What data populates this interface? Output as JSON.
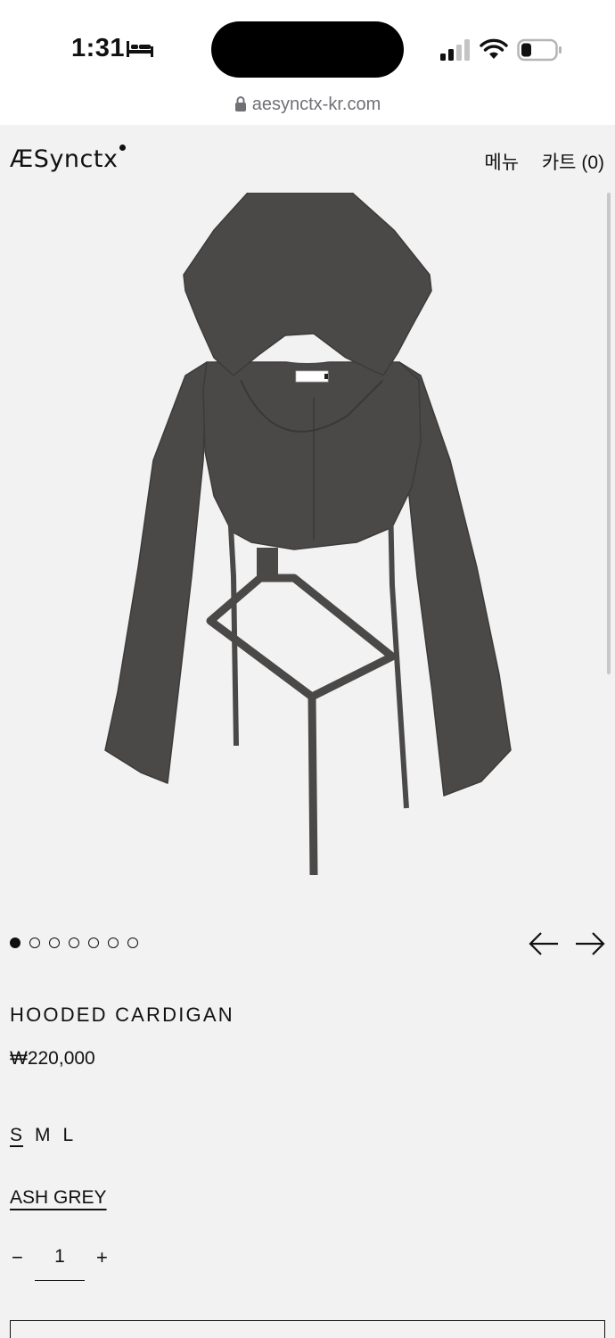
{
  "status_bar": {
    "time": "1:31",
    "url": "aesynctx-kr.com"
  },
  "header": {
    "logo_text": "ÆSynctx",
    "menu_label": "메뉴",
    "cart_label": "카트 (0)"
  },
  "gallery": {
    "image_count": 7,
    "active_index": 0,
    "garment_color": "#4b4848"
  },
  "product": {
    "title": "HOODED CARDIGAN",
    "price": "₩220,000",
    "sizes": [
      "S",
      "M",
      "L"
    ],
    "selected_size": "S",
    "color_name": "ASH GREY",
    "quantity": "1",
    "qty_minus": "−",
    "qty_plus": "+"
  },
  "colors": {
    "background": "#f2f2f2",
    "text": "#111111",
    "url_text": "#707075"
  }
}
